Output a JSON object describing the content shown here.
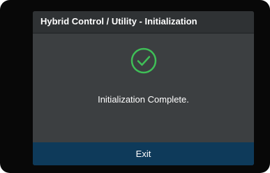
{
  "dialog": {
    "title": "Hybrid Control / Utility - Initialization",
    "message": "Initialization Complete.",
    "exit_label": "Exit",
    "status_icon": "check-circle-icon"
  },
  "colors": {
    "bezel": "#080808",
    "screen_bg": "#3c3f41",
    "title_bar_bg": "#2f3234",
    "success_green": "#3fbf57",
    "exit_button_bg": "#0e3a5a",
    "text": "#ffffff"
  }
}
